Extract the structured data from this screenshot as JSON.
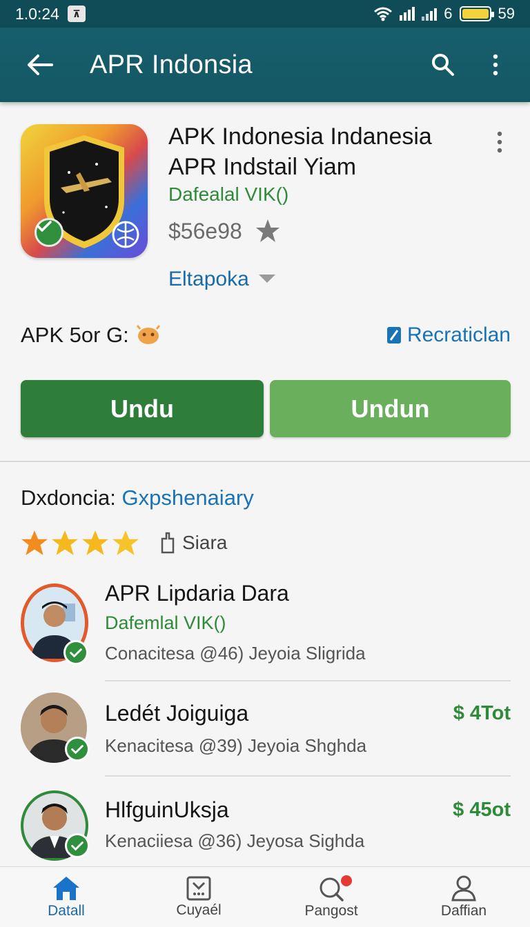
{
  "status_bar": {
    "time": "1.0:24",
    "network": "6",
    "battery": "59"
  },
  "app_bar": {
    "title": "APR Indonsia"
  },
  "app": {
    "title_line1": "APK Indonesia Indanesia",
    "title_line2": "APR Indstail Yiam",
    "developer": "Dafealal VIK()",
    "price": "$56e98",
    "category": "Eltapoka"
  },
  "apk_label": "APK 5or G:",
  "recommendation_link": "Recraticlan",
  "buttons": {
    "primary": "Undu",
    "secondary": "Undun"
  },
  "section": {
    "title": "Dxdoncia:",
    "title_accent": "Gxpshenaiary",
    "rating_stars": 4,
    "share_label": "Siara"
  },
  "list": [
    {
      "name": "APR Lipdaria Dara",
      "sub": "Dafemlal VIK()",
      "meta": "Conacitesa @46) Jeyoia Sligrida",
      "price": ""
    },
    {
      "name": "Ledét Joiguiga",
      "sub": "",
      "meta": "Kenacitesa @39) Jeyoia Shghda",
      "price": "$ 4Tot"
    },
    {
      "name": "HlfguinUksja",
      "sub": "",
      "meta": "Kenaciiesa @36) Jeyosa Sighda",
      "price": "$ 45ot"
    }
  ],
  "bottom_nav": [
    {
      "label": "Datall",
      "icon": "home-icon"
    },
    {
      "label": "Cuyaél",
      "icon": "inbox-icon"
    },
    {
      "label": "Pangost",
      "icon": "search-badge-icon"
    },
    {
      "label": "Daffian",
      "icon": "person-icon"
    }
  ],
  "colors": {
    "app_bar": "#175e6c",
    "green": "#2e7d3a",
    "light_green": "#6aaf5c",
    "link": "#1a73b5"
  }
}
